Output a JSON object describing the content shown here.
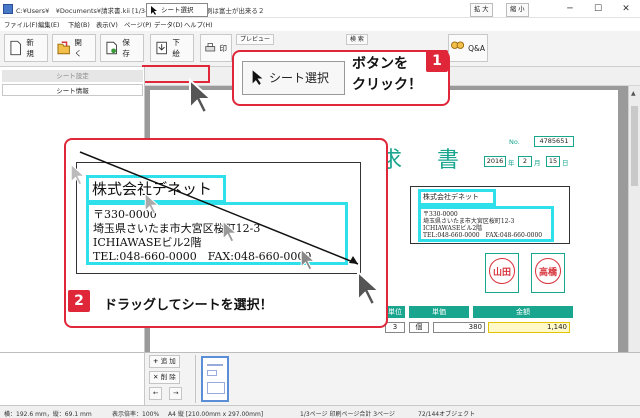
{
  "titlebar": {
    "text": "C:¥Users¥　¥Documents¥請求書.kii [1/3ページ] - かんたん印刷は富士が出来る２",
    "minimize": "─",
    "maximize": "☐",
    "close": "✕"
  },
  "menu": [
    "ファイル(F)",
    "編集(E)",
    "下絵(B)",
    "表示(V)",
    "ページ(P)",
    "データ(D)",
    "ヘルプ(H)"
  ],
  "toolbar": {
    "new": "新 規",
    "open": "開 く",
    "save": "保 存",
    "underlay": "下 絵",
    "print": "印",
    "preview": "プレビュー",
    "search": "検 索",
    "qa": "Q&A"
  },
  "toolbar2": {
    "sheet_select": "シート選択",
    "zoom_in": "拡 大",
    "zoom_out": "縮 小"
  },
  "left_panel": {
    "tab_settings": "シート設定",
    "tab_info": "シート情報"
  },
  "document": {
    "title": "求 書",
    "no_label": "No.",
    "no_value": "4785651",
    "date": {
      "year": "2016",
      "year_unit": "年",
      "month": "2",
      "month_unit": "月",
      "day": "15",
      "day_unit": "日"
    },
    "recipient": {
      "company": "株式会社デネット",
      "postal": "〒330-0000",
      "address1": "埼玉県さいたま市大宮区桜町12-3",
      "address2": "ICHIAWASEビル2階",
      "tel": "TEL:048-660-0000　FAX:048-660-0000"
    },
    "seals": [
      "山田",
      "高橋"
    ],
    "table": {
      "headers": [
        "単位",
        "単価",
        "金額"
      ],
      "row": {
        "qty": "3",
        "unit": "個",
        "price": "380",
        "amount": "1,140"
      }
    }
  },
  "callout1": {
    "button": "シート選択",
    "text_line1": "ボタンを",
    "text_line2": "クリック！",
    "badge": "1"
  },
  "callout2": {
    "company": "株式会社デネット",
    "postal": "〒330-0000",
    "address1": "埼玉県さいたま市大宮区桜町12-3",
    "address2": "ICHIAWASEビル2階",
    "tel": "TEL:048-660-0000　FAX:048-660-0000",
    "text": "ドラッグしてシートを選択！",
    "badge": "2"
  },
  "bottom": {
    "add": "追 加",
    "delete": "削 除",
    "prev": "←",
    "next": "→"
  },
  "status": {
    "pos": "横：192.6 mm，縦：69.1 mm",
    "zoom": "表示倍率：100%",
    "paper": "A4 縦 [210.00mm x 297.00mm]",
    "page": "1/3ページ 印刷ページ合計 3ページ",
    "objects": "72/144オブジェクト"
  },
  "colors": {
    "accent_red": "#e0273a",
    "doc_green": "#1aa58e",
    "selection_cyan": "#2fe0ea"
  }
}
